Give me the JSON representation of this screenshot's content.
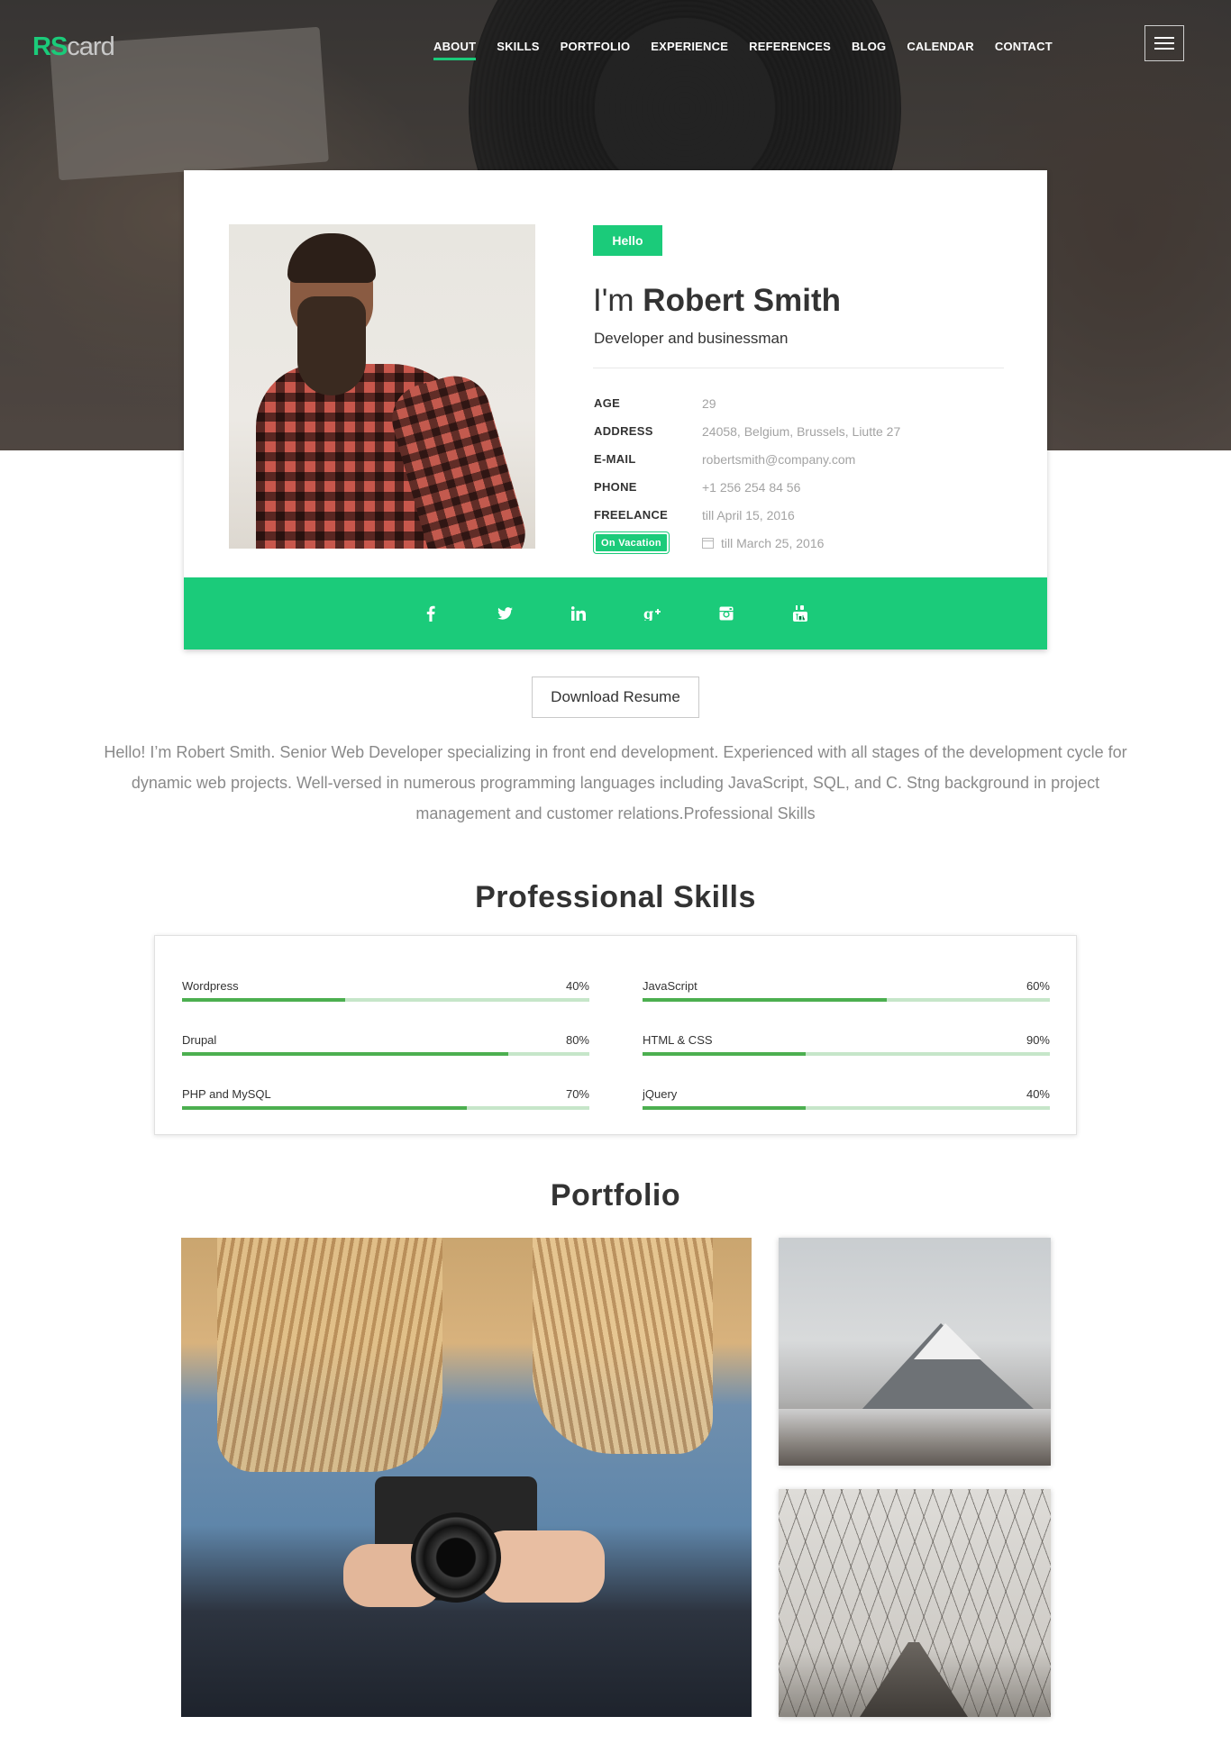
{
  "header": {
    "logo_prefix": "RS",
    "logo_suffix": "card",
    "nav": [
      {
        "label": "ABOUT",
        "active": true
      },
      {
        "label": "SKILLS"
      },
      {
        "label": "PORTFOLIO"
      },
      {
        "label": "EXPERIENCE"
      },
      {
        "label": "REFERENCES"
      },
      {
        "label": "BLOG"
      },
      {
        "label": "CALENDAR"
      },
      {
        "label": "CONTACT"
      }
    ],
    "menu_icon": "hamburger-icon"
  },
  "profile": {
    "hello_badge": "Hello",
    "name_prefix": "I'm",
    "name": "Robert Smith",
    "role": "Developer and businessman",
    "info": [
      {
        "key": "AGE",
        "value": "29"
      },
      {
        "key": "ADDRESS",
        "value": "24058, Belgium, Brussels, Liutte 27"
      },
      {
        "key": "E-MAIL",
        "value": "robertsmith@company.com"
      },
      {
        "key": "PHONE",
        "value": "+1 256 254 84 56"
      },
      {
        "key": "FREELANCE",
        "value": "till April 15, 2016"
      }
    ],
    "vacation_badge": "On Vacation",
    "vacation_value": "till March 25, 2016",
    "social_icons": [
      "facebook-icon",
      "twitter-icon",
      "linkedin-icon",
      "google-plus-icon",
      "instagram-icon",
      "youtube-icon"
    ]
  },
  "download_label": "Download Resume",
  "bio": "Hello! I’m Robert Smith. Senior Web Developer specializing in front end development. Experienced with all stages of the development cycle for dynamic web projects. Well-versed in numerous programming languages including JavaScript, SQL, and C. Stng background in project management and customer relations.Professional Skills",
  "skills": {
    "title": "Professional Skills",
    "items": [
      {
        "name": "Wordpress",
        "percent_label": "40%",
        "value": 0.4
      },
      {
        "name": "JavaScript",
        "percent_label": "60%",
        "value": 0.6
      },
      {
        "name": "Drupal",
        "percent_label": "80%",
        "value": 0.8
      },
      {
        "name": "HTML & CSS",
        "percent_label": "90%",
        "value": 0.4
      },
      {
        "name": "PHP and MySQL",
        "percent_label": "70%",
        "value": 0.7
      },
      {
        "name": "jQuery",
        "percent_label": "40%",
        "value": 0.4
      }
    ]
  },
  "portfolio": {
    "title": "Portfolio"
  },
  "colors": {
    "accent": "#1bcb7a",
    "bar_fill": "#4caf50",
    "bar_track": "#c6e6c9"
  }
}
